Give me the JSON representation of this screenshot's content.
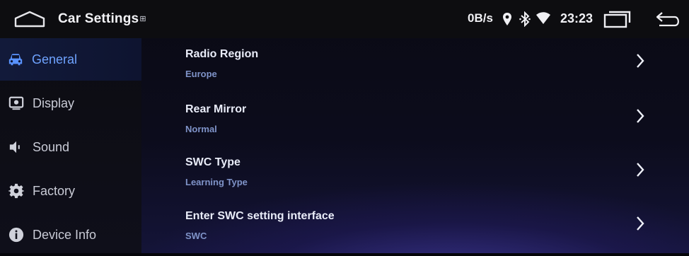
{
  "statusbar": {
    "title": "Car Settings",
    "title_badge": "⊞",
    "net_speed": "0B/s",
    "time": "23:23",
    "icons": [
      "home-icon",
      "location-icon",
      "bluetooth-icon",
      "wifi-icon",
      "recent-apps-icon",
      "back-icon"
    ]
  },
  "sidebar": {
    "items": [
      {
        "label": "General",
        "icon": "car-icon",
        "active": true
      },
      {
        "label": "Display",
        "icon": "display-icon",
        "active": false
      },
      {
        "label": "Sound",
        "icon": "speaker-icon",
        "active": false
      },
      {
        "label": "Factory",
        "icon": "gear-icon",
        "active": false
      },
      {
        "label": "Device Info",
        "icon": "info-icon",
        "active": false
      }
    ]
  },
  "settings": [
    {
      "title": "Radio Region",
      "value": "Europe"
    },
    {
      "title": "Rear Mirror",
      "value": "Normal"
    },
    {
      "title": "SWC Type",
      "value": "Learning Type"
    },
    {
      "title": "Enter SWC setting interface",
      "value": "SWC"
    }
  ],
  "colors": {
    "accent": "#6fa3ff",
    "value_text": "#7f93c8",
    "background": "#0c0c1c",
    "glow": "#463ea8"
  }
}
